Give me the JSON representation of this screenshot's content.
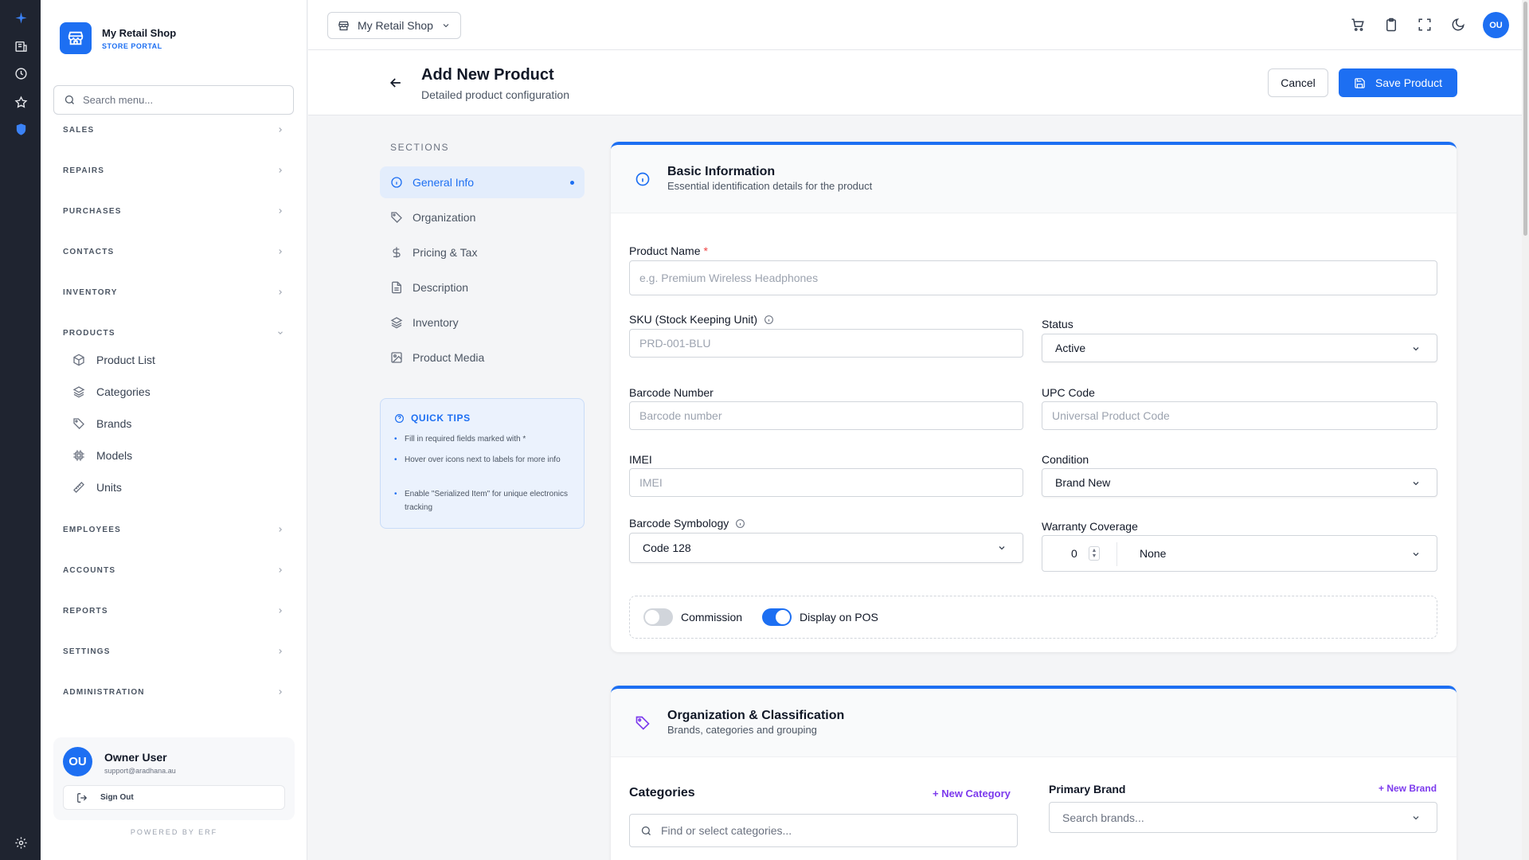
{
  "sidebar": {
    "brand_name": "My Retail Shop",
    "brand_sub": "STORE PORTAL",
    "search_placeholder": "Search menu...",
    "sections": [
      "SALES",
      "REPAIRS",
      "PURCHASES",
      "CONTACTS",
      "INVENTORY",
      "PRODUCTS",
      "EMPLOYEES",
      "ACCOUNTS",
      "REPORTS",
      "SETTINGS",
      "ADMINISTRATION"
    ],
    "products_items": [
      "Product List",
      "Categories",
      "Brands",
      "Models",
      "Units"
    ],
    "user": {
      "initials": "OU",
      "name": "Owner User",
      "email": "support@aradhana.au",
      "signout": "Sign Out"
    },
    "powered_by": "POWERED BY ERF"
  },
  "topbar": {
    "shop_name": "My Retail Shop",
    "avatar_initials": "OU"
  },
  "header": {
    "title": "Add New Product",
    "subtitle": "Detailed product configuration",
    "cancel": "Cancel",
    "save": "Save Product"
  },
  "section_nav": {
    "label": "SECTIONS",
    "items": [
      "General Info",
      "Organization",
      "Pricing & Tax",
      "Description",
      "Inventory",
      "Product Media"
    ],
    "active": "General Info"
  },
  "quick_tips": {
    "title": "QUICK TIPS",
    "tips": [
      "Fill in required fields marked with *",
      "Hover over icons next to labels for more info",
      "Enable \"Serialized Item\" for unique electronics tracking"
    ]
  },
  "basic_info": {
    "title": "Basic Information",
    "subtitle": "Essential identification details for the product",
    "product_name_label": "Product Name",
    "product_name_required": "*",
    "product_name_placeholder": "e.g. Premium Wireless Headphones",
    "sku_label": "SKU (Stock Keeping Unit)",
    "sku_placeholder": "PRD-001-BLU",
    "status_label": "Status",
    "status_value": "Active",
    "barcode_label": "Barcode Number",
    "barcode_placeholder": "Barcode number",
    "upc_label": "UPC Code",
    "upc_placeholder": "Universal Product Code",
    "imei_label": "IMEI",
    "imei_placeholder": "IMEI",
    "condition_label": "Condition",
    "condition_value": "Brand New",
    "symbology_label": "Barcode Symbology",
    "symbology_value": "Code 128",
    "warranty_label": "Warranty Coverage",
    "warranty_number": "0",
    "warranty_unit": "None",
    "commission_label": "Commission",
    "commission_on": false,
    "pos_label": "Display on POS",
    "pos_on": true
  },
  "organization": {
    "title": "Organization & Classification",
    "subtitle": "Brands, categories and grouping",
    "categories_label": "Categories",
    "new_category": "+ New Category",
    "categories_placeholder": "Find or select categories...",
    "brand_label": "Primary Brand",
    "new_brand": "+ New Brand",
    "brand_placeholder": "Search brands..."
  },
  "colors": {
    "accent": "#1d6ff2",
    "purple": "#7c3aed",
    "rail": "#1f2430"
  }
}
